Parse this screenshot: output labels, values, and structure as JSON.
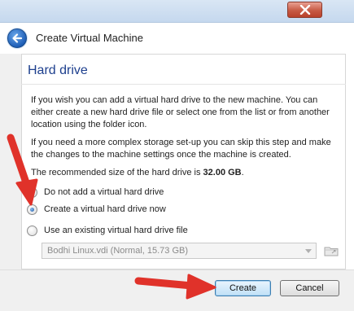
{
  "window": {
    "title": "Create Virtual Machine"
  },
  "page": {
    "section_title": "Hard drive",
    "paragraph1": "If you wish you can add a virtual hard drive to the new machine. You can either create a new hard drive file or select one from the list or from another location using the folder icon.",
    "paragraph2": "If you need a more complex storage set-up you can skip this step and make the changes to the machine settings once the machine is created.",
    "recommended_prefix": "The recommended size of the hard drive is ",
    "recommended_size": "32.00 GB",
    "recommended_suffix": "."
  },
  "options": [
    {
      "label": "Do not add a virtual hard drive",
      "checked": false
    },
    {
      "label": "Create a virtual hard drive now",
      "checked": true
    },
    {
      "label": "Use an existing virtual hard drive file",
      "checked": false
    }
  ],
  "existing_file": {
    "selected": "Bodhi Linux.vdi (Normal, 15.73 GB)",
    "enabled": false
  },
  "buttons": {
    "create": "Create",
    "cancel": "Cancel"
  },
  "icons": {
    "back": "back-arrow-icon",
    "close": "close-icon",
    "folder": "folder-icon"
  },
  "colors": {
    "section_title": "#1d3f8e",
    "annotation_arrow": "#e0322a",
    "close_button": "#c75a44"
  }
}
